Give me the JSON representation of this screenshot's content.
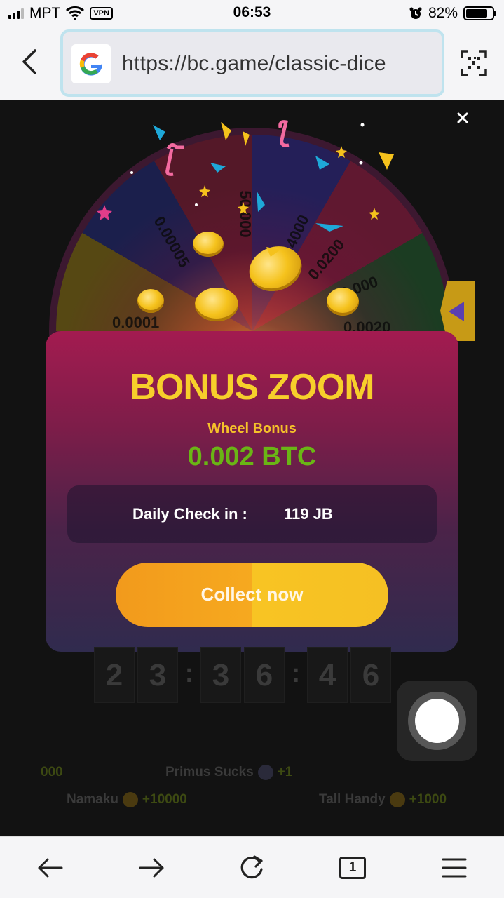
{
  "status_bar": {
    "carrier": "MPT",
    "vpn_label": "VPN",
    "time": "06:53",
    "battery_percent": "82%",
    "battery_level": 0.82
  },
  "browser": {
    "url": "https://bc.game/classic-dice",
    "search_badge_icon": "google-g-icon",
    "tab_count": "1"
  },
  "wheel": {
    "segment_labels": [
      "0.00005",
      "50.000",
      "4000",
      "0.0200",
      "0.000",
      "0.0001",
      "0.0020"
    ]
  },
  "bonus_modal": {
    "title": "BONUS ZOOM",
    "subtitle": "Wheel Bonus",
    "amount": "0.002 BTC",
    "checkin_label": "Daily Check in :",
    "checkin_value": "119 JB",
    "collect_label": "Collect now",
    "accent_color": "#f7cf2b",
    "amount_color": "#6ab515"
  },
  "countdown": {
    "digits": [
      "2",
      "3",
      "3",
      "6",
      "4",
      "6"
    ],
    "separator": ":"
  },
  "ticker": {
    "row1_left_amount": "000",
    "row1_name": "Primus Sucks",
    "row1_amount": "+1",
    "row2_left_name": "Namaku",
    "row2_left_amount": "+10000",
    "row2_right_name": "Tall Handy",
    "row2_right_amount": "+1000"
  }
}
